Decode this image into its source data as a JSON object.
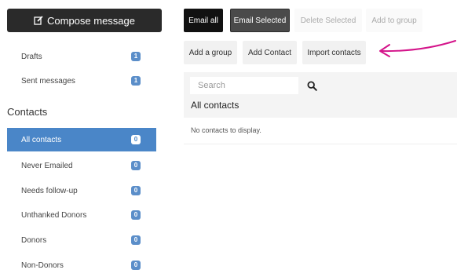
{
  "compose": {
    "label": "Compose message",
    "icon": "edit-icon"
  },
  "sidebar": {
    "mail_items": [
      {
        "label": "Drafts",
        "count": "1"
      },
      {
        "label": "Sent messages",
        "count": "1"
      }
    ],
    "contacts_heading": "Contacts",
    "contact_items": [
      {
        "label": "All contacts",
        "count": "0",
        "active": true
      },
      {
        "label": "Never Emailed",
        "count": "0"
      },
      {
        "label": "Needs follow-up",
        "count": "0"
      },
      {
        "label": "Unthanked Donors",
        "count": "0"
      },
      {
        "label": "Donors",
        "count": "0"
      },
      {
        "label": "Non-Donors",
        "count": "0"
      }
    ]
  },
  "toolbar": {
    "email_all": "Email all",
    "email_selected": "Email Selected",
    "delete_selected": "Delete Selected",
    "add_to_group": "Add to group",
    "add_a_group": "Add a group",
    "add_contact": "Add Contact",
    "import_contacts": "Import contacts"
  },
  "search": {
    "placeholder": "Search",
    "icon": "search-icon"
  },
  "list": {
    "title": "All contacts",
    "empty_message": "No contacts to display."
  },
  "annotation": {
    "type": "arrow",
    "color": "#d4148a"
  },
  "colors": {
    "active": "#4a86c8",
    "badge": "#5b8ec9",
    "dark": "#111111",
    "compose": "#2a2a2a"
  }
}
